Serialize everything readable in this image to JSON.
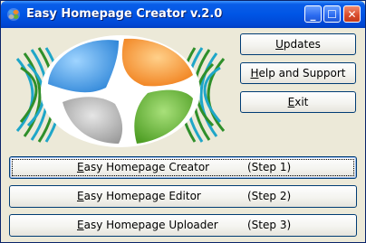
{
  "window": {
    "title": "Easy Homepage Creator v.2.0",
    "controls": {
      "minimize": "_",
      "maximize": "☐",
      "close": "✕"
    },
    "accent_colors": {
      "titlebar": "#0055e5",
      "close": "#d84a2a"
    }
  },
  "side_buttons": {
    "updates": {
      "mnemonic": "U",
      "rest": "pdates"
    },
    "help": {
      "mnemonic": "H",
      "rest": "elp and Support"
    },
    "exit": {
      "mnemonic": "E",
      "rest": "xit"
    }
  },
  "steps": [
    {
      "mnemonic": "E",
      "rest": "asy Homepage Creator",
      "step": "(Step 1)"
    },
    {
      "mnemonic": "E",
      "rest": "asy Homepage Editor",
      "step": "(Step 2)"
    },
    {
      "mnemonic": "E",
      "rest": "asy Homepage Uploader",
      "step": "(Step 3)"
    }
  ],
  "logo": {
    "colors": {
      "blue": "#4aa3e6",
      "orange": "#f08a28",
      "green": "#62b034",
      "gray": "#b0b0b0",
      "stripes_cyan": "#1fa6c8",
      "stripes_green": "#2f8f2a"
    }
  }
}
